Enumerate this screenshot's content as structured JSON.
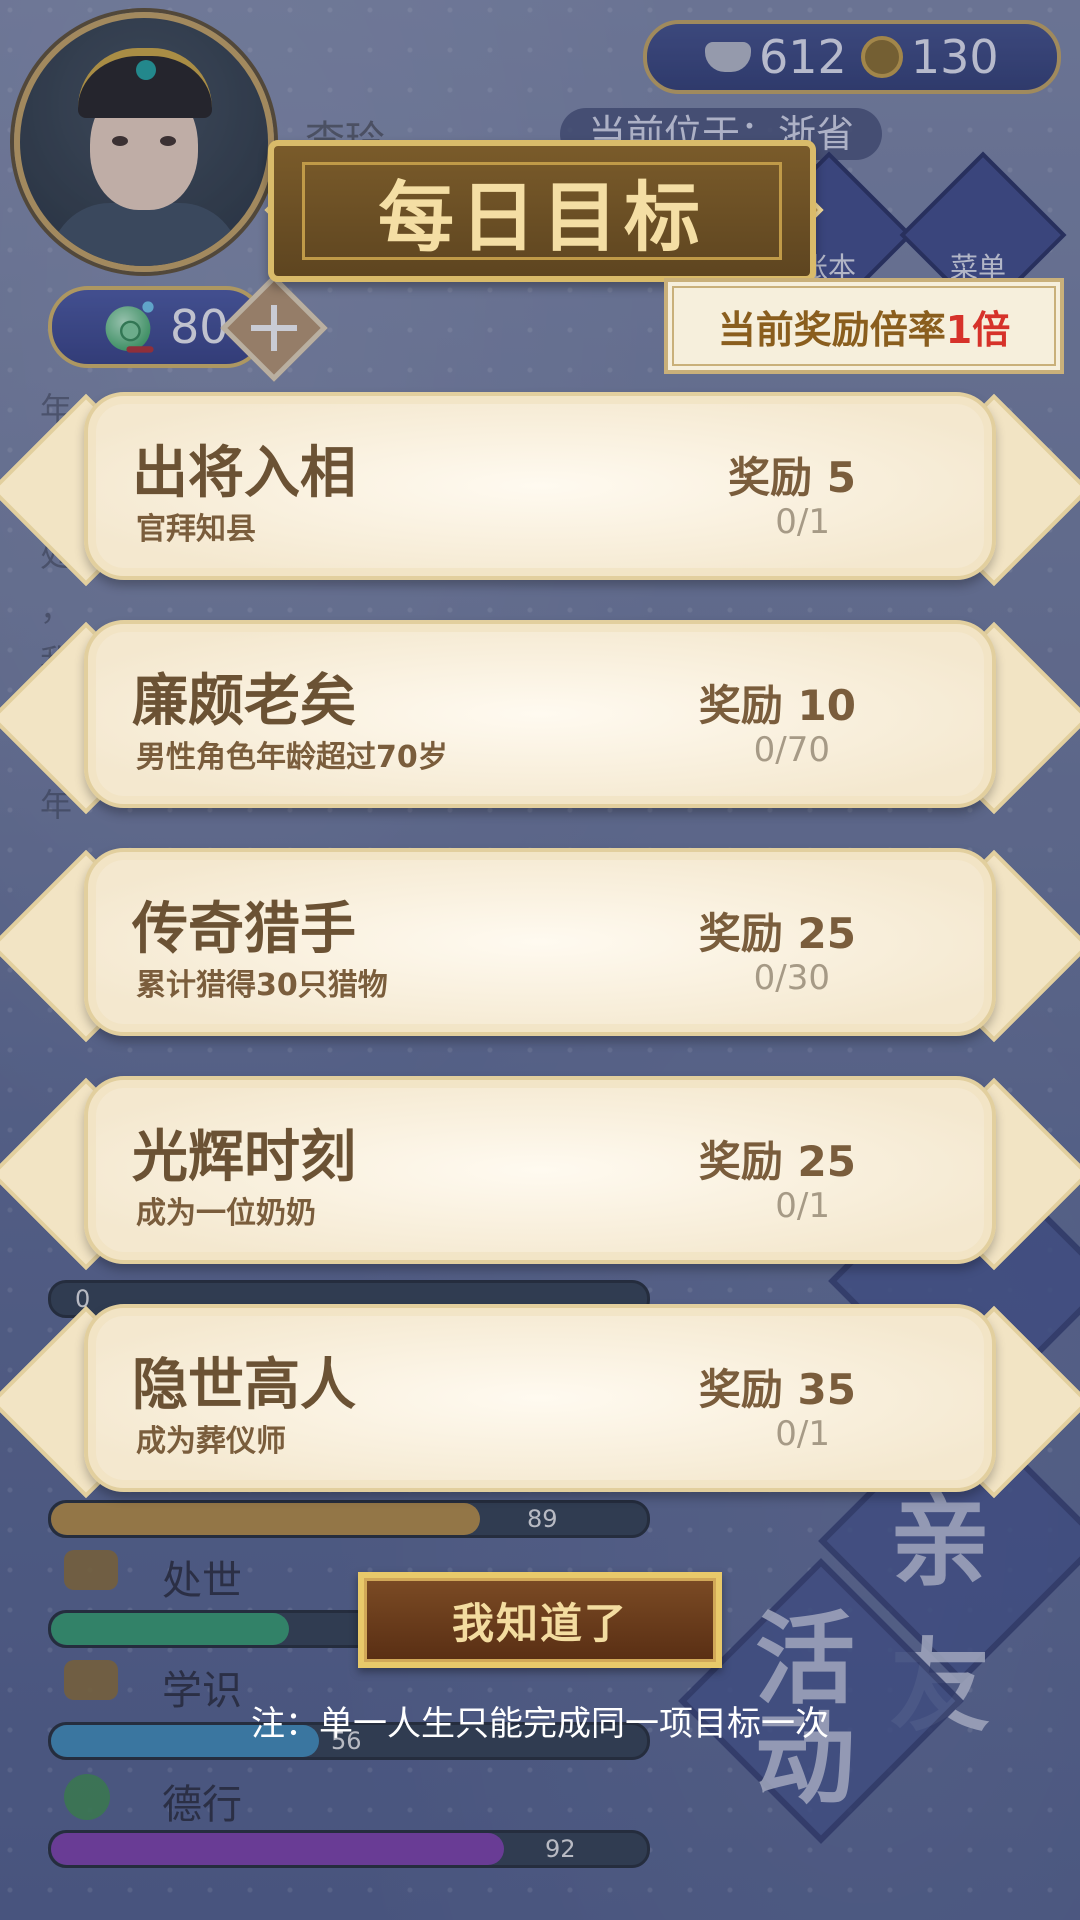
{
  "header": {
    "silver": "612",
    "coins": "130",
    "character_name": "李玲",
    "location": "当前位于：浙省",
    "nav": [
      {
        "label": "账本",
        "icon": "book-icon"
      },
      {
        "label": "菜单",
        "icon": "menu-dots-icon"
      }
    ],
    "jade_count": "80"
  },
  "dialog": {
    "title": "每日目标",
    "multiplier_prefix": "当前奖励倍率",
    "multiplier_value": "1倍",
    "tasks": [
      {
        "title": "出将入相",
        "desc": "官拜知县",
        "reward": "奖励 5",
        "progress": "0/1"
      },
      {
        "title": "廉颇老矣",
        "desc": "男性角色年龄超过70岁",
        "reward": "奖励 10",
        "progress": "0/70"
      },
      {
        "title": "传奇猎手",
        "desc": "累计猎得30只猎物",
        "reward": "奖励 25",
        "progress": "0/30"
      },
      {
        "title": "光辉时刻",
        "desc": "成为一位奶奶",
        "reward": "奖励 25",
        "progress": "0/1"
      },
      {
        "title": "隐世高人",
        "desc": "成为葬仪师",
        "reward": "奖励 35",
        "progress": "0/1"
      }
    ],
    "ok_button": "我知道了",
    "note": "注：单一人生只能完成同一项目标一次"
  },
  "background": {
    "stats": [
      {
        "label": "",
        "value": "0",
        "percent": 0
      },
      {
        "label": "",
        "value": "89",
        "percent": 72
      },
      {
        "label": "处世",
        "value": "",
        "percent": 40
      },
      {
        "label": "学识",
        "value": "56",
        "percent": 45
      },
      {
        "label": "德行",
        "value": "92",
        "percent": 76
      }
    ],
    "big_buttons": [
      "亲友",
      "活动"
    ]
  },
  "colors": {
    "accent_gold": "#d9bb6a",
    "reward_red": "#d6322a",
    "card_bg": "#f4e8cf"
  }
}
